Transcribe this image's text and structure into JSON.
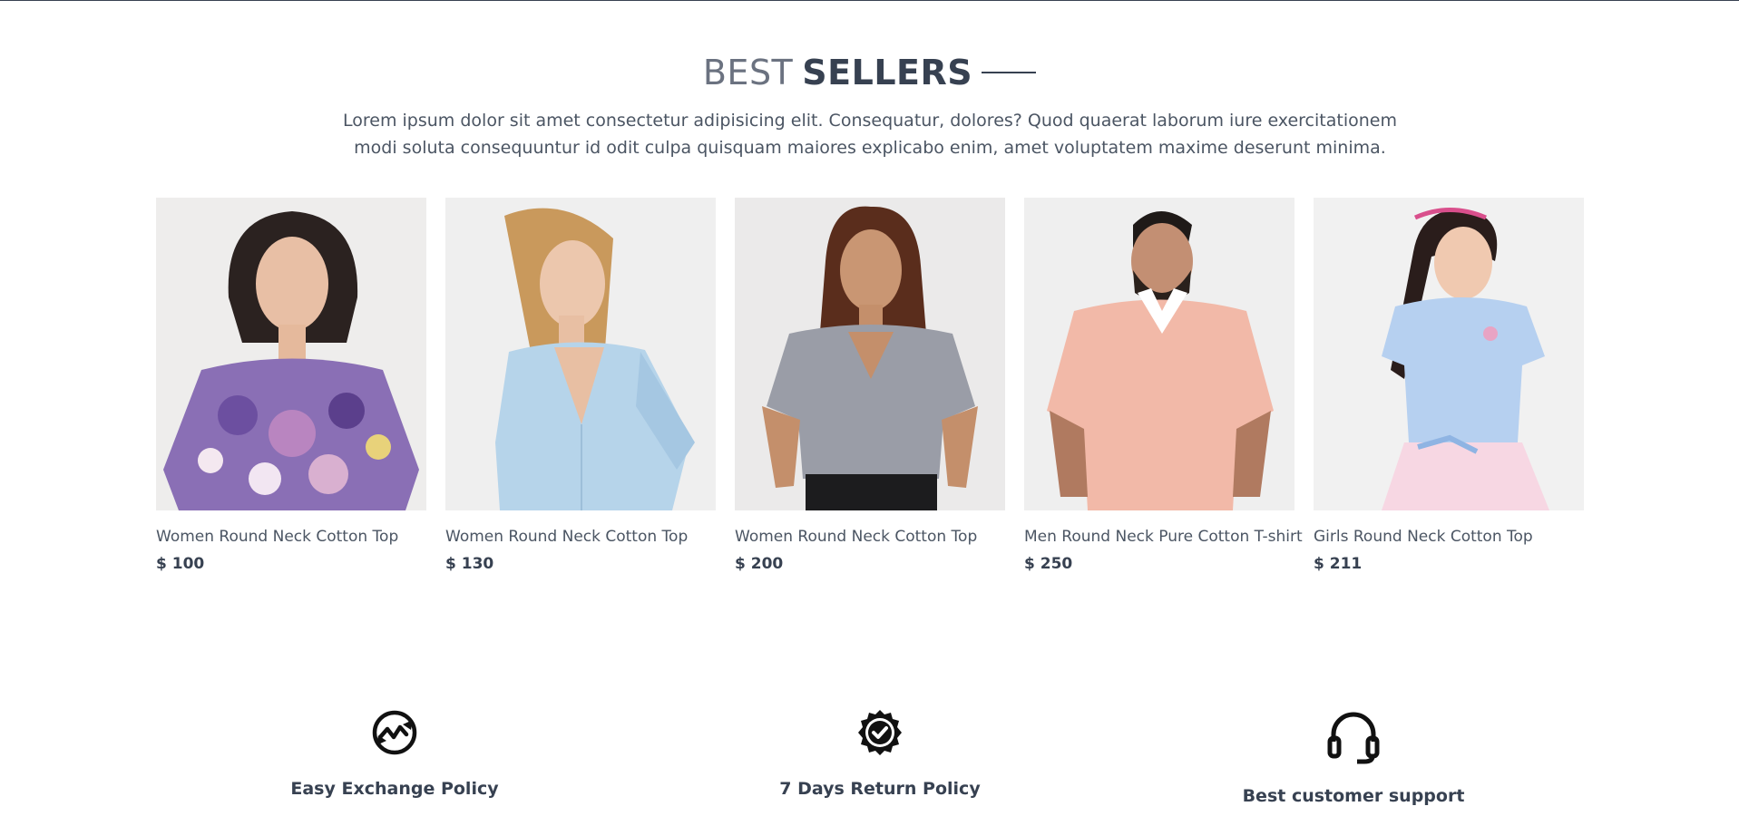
{
  "section": {
    "title_light": "BEST",
    "title_bold": "SELLERS",
    "description": "Lorem ipsum dolor sit amet consectetur adipisicing elit. Consequatur, dolores? Quod quaerat laborum iure exercitationem modi soluta consequuntur id odit culpa quisquam maiores explicabo enim, amet voluptatem maxime deserunt minima."
  },
  "products": [
    {
      "name": "Women Round Neck Cotton Top",
      "price": "$ 100",
      "image": "woman-floral-off-shoulder-top-photo"
    },
    {
      "name": "Women Round Neck Cotton Top",
      "price": "$ 130",
      "image": "woman-light-blue-shirt-photo"
    },
    {
      "name": "Women Round Neck Cotton Top",
      "price": "$ 200",
      "image": "woman-grey-vneck-tshirt-photo"
    },
    {
      "name": "Men Round Neck Pure Cotton T-shirt",
      "price": "$ 250",
      "image": "man-peach-polo-shirt-photo"
    },
    {
      "name": "Girls Round Neck Cotton Top",
      "price": "$ 211",
      "image": "girl-blue-top-pink-skirt-photo"
    }
  ],
  "features": [
    {
      "title": "Easy Exchange Policy",
      "icon": "exchange-icon"
    },
    {
      "title": "7 Days Return Policy",
      "icon": "quality-badge-icon"
    },
    {
      "title": "Best customer support",
      "icon": "headset-support-icon"
    }
  ]
}
